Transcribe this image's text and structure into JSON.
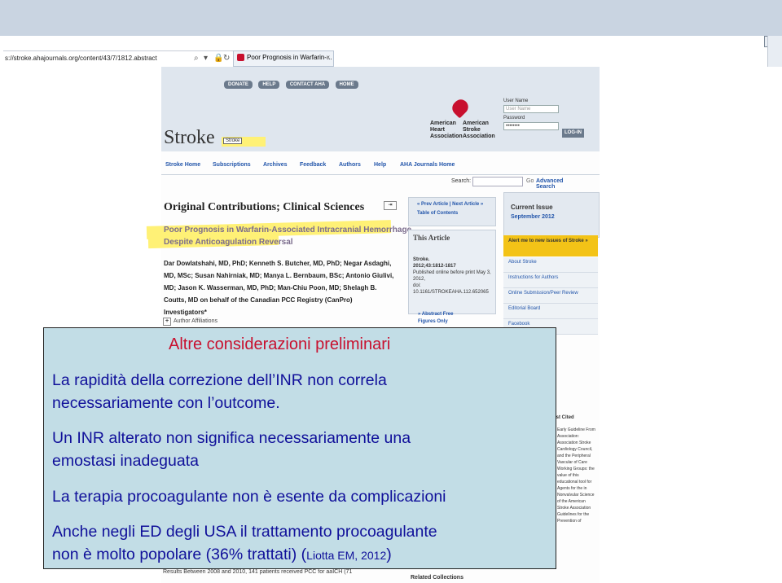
{
  "browser": {
    "address_url": "s://stroke.ahajournals.org/content/43/7/1812.abstract",
    "tab_label": "Poor Prognosis in Warfarin-...",
    "tab_close": "×"
  },
  "site": {
    "top_buttons": [
      "DONATE",
      "HELP",
      "CONTACT AHA",
      "HOME"
    ],
    "journal_logo": "Stroke",
    "logo_tag": "Stroke",
    "aha_heart": [
      "American",
      "Heart",
      "Association"
    ],
    "aha_stroke": [
      "American",
      "Stroke",
      "Association"
    ],
    "login": {
      "user_label": "User Name",
      "user_placeholder": "User Name",
      "password_label": "Password",
      "password_value": "••••••••",
      "button": "LOG-IN"
    },
    "nav": [
      "Stroke Home",
      "Subscriptions",
      "Archives",
      "Feedback",
      "Authors",
      "Help",
      "AHA Journals Home"
    ],
    "search_label": "Search:",
    "search_go": "Go",
    "advanced_search": "Advanced Search",
    "section_title": "Original Contributions; Clinical Sciences",
    "article_title_1": "Poor Prognosis in Warfarin-Associated Intracranial Hemorrhage",
    "article_title_2": "Despite Anticoagulation Reversal",
    "authors": "Dar Dowlatshahi, MD, PhD; Kenneth S. Butcher, MD, PhD; Negar Asdaghi, MD, MSc; Susan Nahirniak, MD; Manya L. Bernbaum, BSc; Antonio Giulivi, MD; Jason K. Wasserman, MD, PhD; Man-Chiu Poon, MD; Shelagh B. Coutts, MD on behalf of the Canadian PCC Registry (CanPro) Investigators*",
    "author_affiliations": "Author Affiliations",
    "results_snippet": "Results  Between 2008 and 2010, 141 patients received PCC for aaICH (71",
    "prev_next": "« Prev Article | Next Article »",
    "toc": "Table of Contents",
    "this_article": "This Article",
    "citation_1": "Stroke.",
    "citation_2": "2012;43:1812-1817",
    "citation_3": "Published online before print May 3, 2012,",
    "citation_4": "doi: 10.1161/STROKEAHA.112.652065",
    "abstract_link": "» Abstract Free",
    "figures_link": "Figures Only",
    "related": "Related Collections",
    "current_issue": "Current Issue",
    "current_issue_date": "September 2012",
    "alert": "Alert me to new issues of Stroke »",
    "side_links": [
      "About Stroke",
      "Instructions for Authors",
      "Online Submission/Peer Review",
      "Editorial Board",
      "Facebook"
    ],
    "most_cited": "Most Cited",
    "cited_items": "Early Guideline From Association: Association Stroke Cardiology Council, and the Peripheral Vascular of Care Working Groups: the value of this educational tool for Agents for the in Nonvalvular Science of the American Stroke Association Guidelines for the Prevention of"
  },
  "overlay": {
    "title": "Altre considerazioni preliminari",
    "p1_line1": "La rapidità della correzione dell’INR non correla",
    "p1_line2": "necessariamente con l’outcome.",
    "p2_line1": "Un INR alterato non significa necessariamente una",
    "p2_line2": "emostasi inadeguata",
    "p3": "La terapia procoagulante non è esente da complicazioni",
    "p4_line1": "Anche negli ED degli USA il trattamento procoagulante",
    "p4_line2": "non è molto popolare (36% trattati) (",
    "p4_cite": "Liotta EM, 2012",
    "p4_close": ")"
  },
  "colors": {
    "title_red": "#c8102e",
    "text_blue": "#10109a",
    "overlay_bg": "#c2dde6",
    "highlight": "#fff176"
  }
}
